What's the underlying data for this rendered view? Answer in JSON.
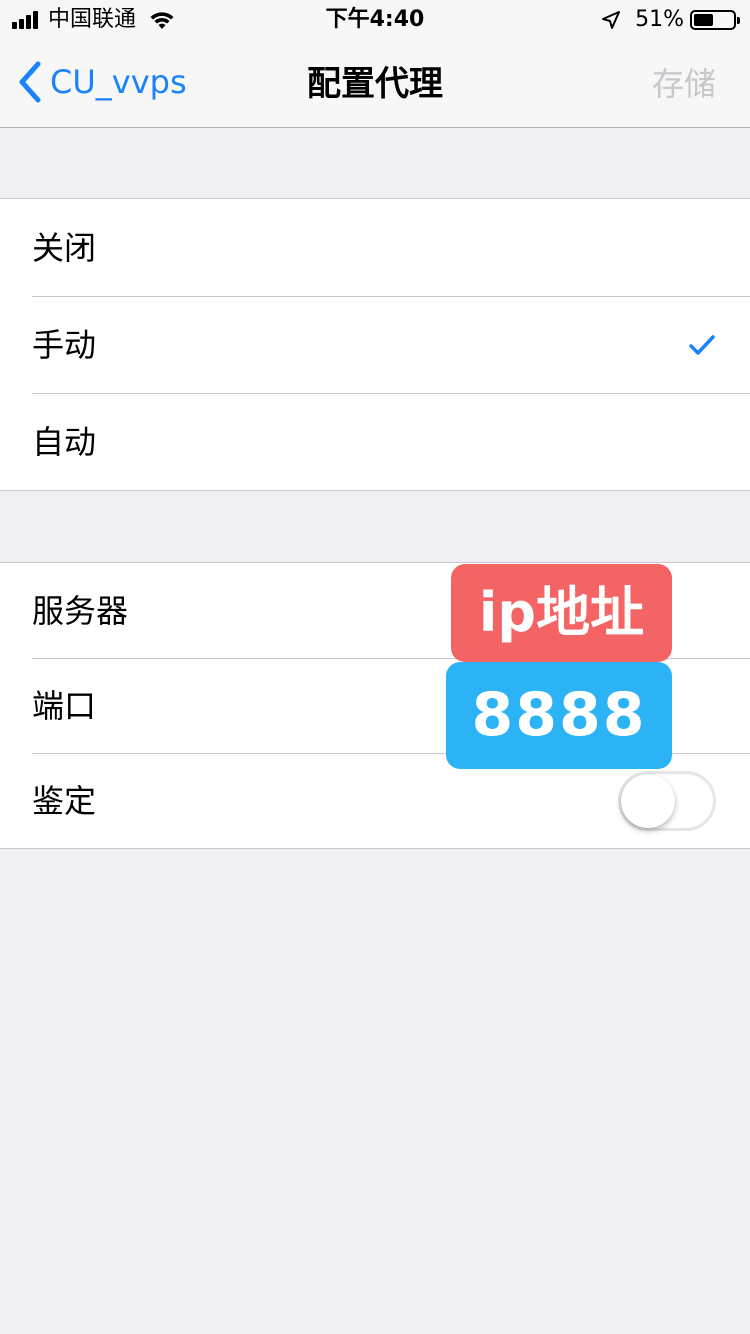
{
  "status_bar": {
    "carrier": "中国联通",
    "time": "下午4:40",
    "battery_percent_label": "51%",
    "battery_level": 0.51
  },
  "nav": {
    "back_label": "CU_vvps",
    "title": "配置代理",
    "save_label": "存储"
  },
  "mode_group": {
    "selected": "手动",
    "items": [
      {
        "label": "关闭",
        "checked": false
      },
      {
        "label": "手动",
        "checked": true
      },
      {
        "label": "自动",
        "checked": false
      }
    ]
  },
  "manual_group": {
    "server_label": "服务器",
    "port_label": "端口",
    "auth_label": "鉴定",
    "auth_enabled": false
  },
  "annotations": {
    "server_tag": "ip地址",
    "port_tag": "8888",
    "server_tag_color": "#f46464",
    "port_tag_color": "#2bb3f6"
  },
  "colors": {
    "accent": "#1a82fb",
    "background": "#efeff4",
    "disabled": "#c7c7cc"
  }
}
